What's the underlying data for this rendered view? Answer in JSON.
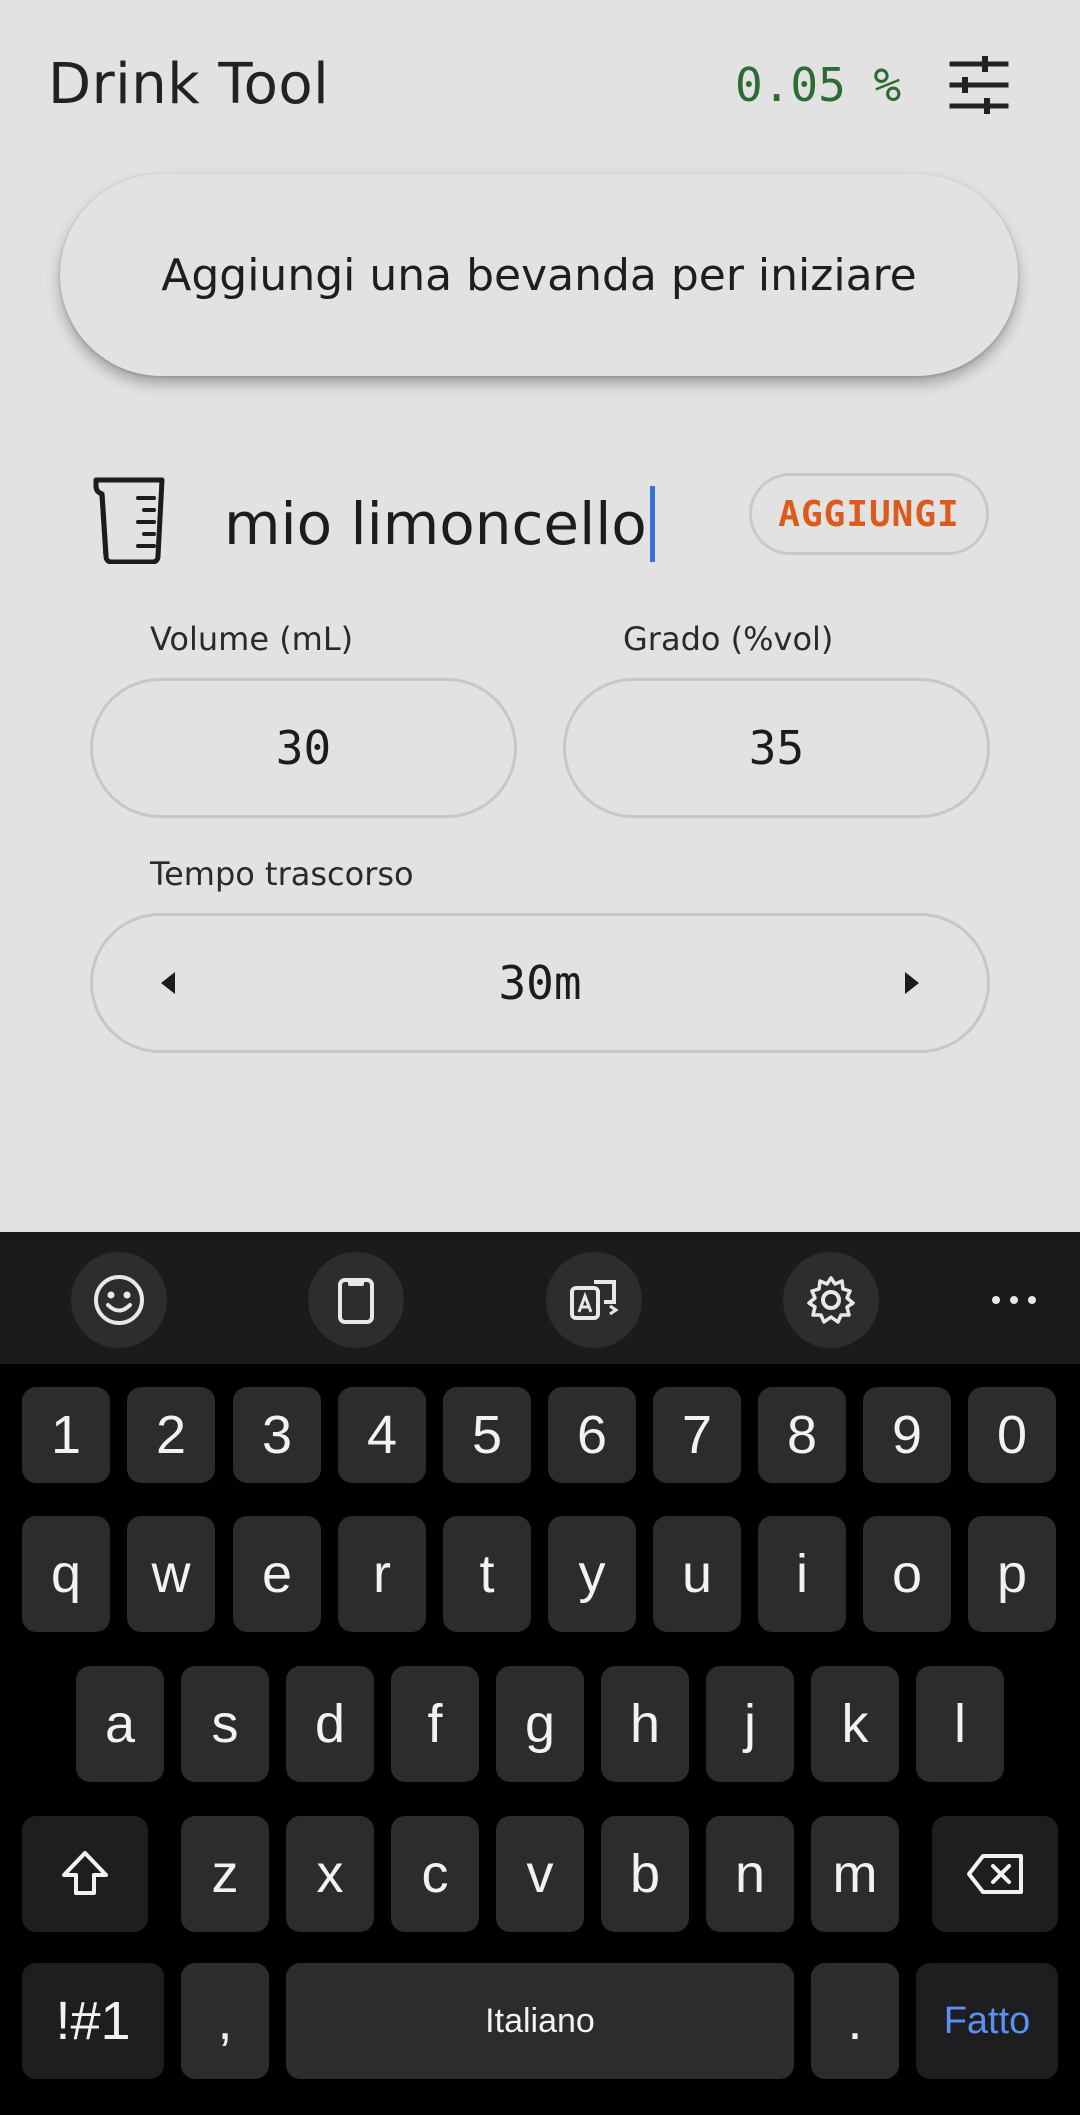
{
  "app": {
    "title": "Drink Tool",
    "bac_value": "0.05 %",
    "banner_text": "Aggiungi una bevanda per iniziare",
    "drink_name": "mio limoncello",
    "add_label": "AGGIUNGI",
    "volume_label": "Volume (mL)",
    "volume_value": "30",
    "grade_label": "Grado (%vol)",
    "grade_value": "35",
    "time_label": "Tempo trascorso",
    "time_value": "30m"
  },
  "keyboard": {
    "toolbar": [
      "emoji-icon",
      "clipboard-icon",
      "translate-icon",
      "settings-icon",
      "more-icon"
    ],
    "row_numbers": [
      "1",
      "2",
      "3",
      "4",
      "5",
      "6",
      "7",
      "8",
      "9",
      "0"
    ],
    "row1": [
      "q",
      "w",
      "e",
      "r",
      "t",
      "y",
      "u",
      "i",
      "o",
      "p"
    ],
    "row2": [
      "a",
      "s",
      "d",
      "f",
      "g",
      "h",
      "j",
      "k",
      "l"
    ],
    "row3": [
      "z",
      "x",
      "c",
      "v",
      "b",
      "n",
      "m"
    ],
    "symbols_label": "!#1",
    "comma_label": ",",
    "space_label": "Italiano",
    "period_label": ".",
    "done_label": "Fatto"
  },
  "colors": {
    "background": "#e2e2e2",
    "bac_green": "#2e6b32",
    "add_orange": "#dd5a1d",
    "caret_blue": "#3a6fd8",
    "done_blue": "#5b8ff0"
  }
}
